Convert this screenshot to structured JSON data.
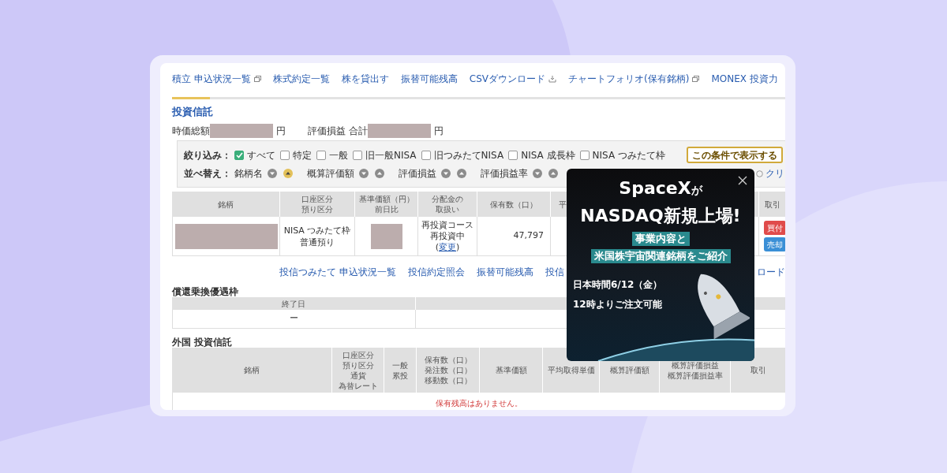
{
  "nav_tabs": [
    {
      "label": "積立 申込状況一覧",
      "kind": "external",
      "selected": true
    },
    {
      "label": "株式約定一覧",
      "kind": "plain",
      "selected": false
    },
    {
      "label": "株を貸出す",
      "kind": "plain",
      "selected": false
    },
    {
      "label": "振替可能残高",
      "kind": "plain",
      "selected": false
    },
    {
      "label": "CSVダウンロード",
      "kind": "download",
      "selected": false
    },
    {
      "label": "チャートフォリオ(保有銘柄)",
      "kind": "external",
      "selected": false
    },
    {
      "label": "MONEX 投資力",
      "kind": "plain",
      "selected": false
    }
  ],
  "section_title": "投資信託",
  "totals": [
    {
      "label": "時価総額",
      "unit": "円"
    },
    {
      "label": "評価損益 合計",
      "unit": "円"
    }
  ],
  "filter": {
    "label": "絞り込み：",
    "options": [
      {
        "label": "すべて",
        "checked": true
      },
      {
        "label": "特定",
        "checked": false
      },
      {
        "label": "一般",
        "checked": false
      },
      {
        "label": "旧一般NISA",
        "checked": false
      },
      {
        "label": "旧つみたてNISA",
        "checked": false
      },
      {
        "label": "NISA 成長枠",
        "checked": false
      },
      {
        "label": "NISA つみたて枠",
        "checked": false
      }
    ],
    "apply_button": "この条件で表示する"
  },
  "sort": {
    "label": "並べ替え：",
    "fields": [
      {
        "label": "銘柄名",
        "descending": {
          "selected": false
        },
        "ascending": {
          "selected": true
        }
      },
      {
        "label": "概算評価額",
        "descending": {
          "selected": false
        },
        "ascending": {
          "selected": false
        }
      },
      {
        "label": "評価損益",
        "descending": {
          "selected": false
        },
        "ascending": {
          "selected": false
        }
      },
      {
        "label": "評価損益率",
        "descending": {
          "selected": false
        },
        "ascending": {
          "selected": false
        }
      }
    ],
    "clear": "クリ"
  },
  "holdings_table": {
    "columns": [
      [
        "銘柄"
      ],
      [
        "口座区分",
        "預り区分"
      ],
      [
        "基準価額（円）",
        "前日比"
      ],
      [
        "分配金の",
        "取扱い"
      ],
      [
        "保有数（口）"
      ],
      [
        "平"
      ],
      [
        "取引"
      ]
    ],
    "rows": [
      {
        "account": [
          "NISA つみたて枠",
          "普通預り"
        ],
        "distribution": [
          "再投資コース",
          "再投資中"
        ],
        "change_link": {
          "before": "(",
          "label": "変更",
          "after": ")"
        },
        "quantity": "47,797",
        "buy_button": "買付",
        "sell_button": "売却"
      }
    ]
  },
  "links": [
    "投信つみたて 申込状況一覧",
    "投信約定照会",
    "振替可能残高",
    "投信"
  ],
  "links_right": "ロード",
  "exchange_table": {
    "title": "償還乗換優遇枠",
    "columns": [
      "終了日"
    ],
    "rows": [
      [
        "ー"
      ]
    ]
  },
  "foreign_funds": {
    "title": "外国 投資信託",
    "columns": [
      [
        "銘柄"
      ],
      [
        "口座区分",
        "預り区分",
        "通貨",
        "為替レート"
      ],
      [
        "一般",
        "累投"
      ],
      [
        "保有数（口）",
        "発注数（口）",
        "移動数（口）"
      ],
      [
        "基準価額"
      ],
      [
        "平均取得単価"
      ],
      [
        "概算評価額"
      ],
      [
        "概算評価損益",
        "概算評価損益率"
      ],
      [
        "取引"
      ]
    ],
    "empty_message": "保有残高はありません。"
  },
  "ad": {
    "title": "SpaceX",
    "title_suffix": "が",
    "title_2": "NASDAQ新規上場!",
    "highlight_lines": [
      "事業内容と",
      "米国株宇宙関連銘柄をご紹介"
    ],
    "date_lines": [
      "日本時間6/12（金）",
      "12時よりご注文可能"
    ]
  }
}
